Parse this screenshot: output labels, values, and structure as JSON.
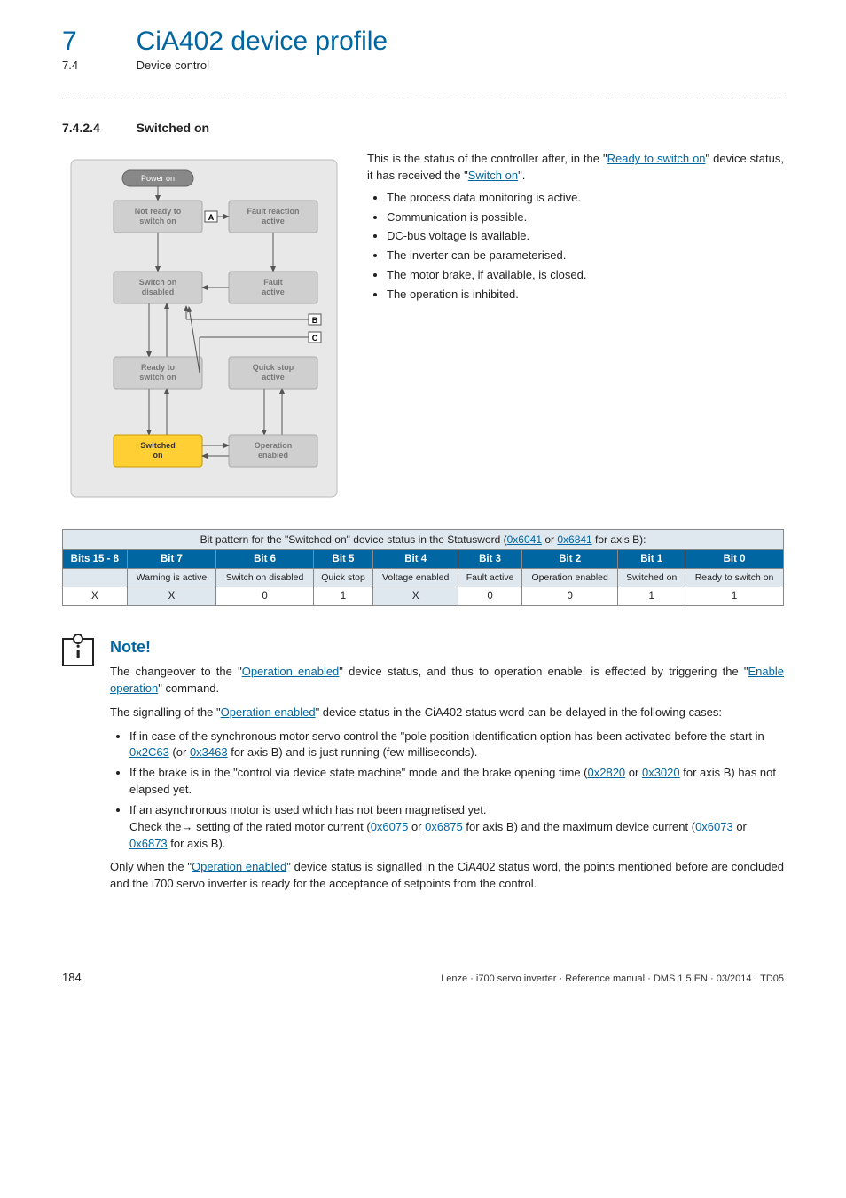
{
  "header": {
    "chapter_num": "7",
    "chapter_title": "CiA402 device profile",
    "sub_num": "7.4",
    "sub_title": "Device control"
  },
  "section": {
    "num": "7.4.2.4",
    "title": "Switched on"
  },
  "diagram": {
    "power_on": "Power on",
    "not_ready": "Not ready to switch on",
    "fault_reaction": "Fault reaction active",
    "switch_on_disabled": "Switch on disabled",
    "fault_active": "Fault active",
    "ready": "Ready to switch on",
    "quick_stop": "Quick stop active",
    "switched_on": "Switched on",
    "operation_enabled": "Operation enabled",
    "label_a": "A",
    "label_b": "B",
    "label_c": "C"
  },
  "right": {
    "intro_1": "This is the status of the controller after, in the \"",
    "link_ready": "Ready to switch on",
    "intro_2": "\" device status, it has received the \"",
    "link_switch_on": "Switch on",
    "intro_3": "\".",
    "bullets": [
      "The process data monitoring is active.",
      "Communication is possible.",
      "DC-bus voltage is available.",
      "The inverter can be parameterised.",
      "The motor brake, if available, is closed.",
      "The operation is inhibited."
    ]
  },
  "table": {
    "caption_1": "Bit pattern for the \"Switched on\" device status in the Statusword (",
    "link1": "0x6041",
    "cap_or": " or ",
    "link2": "0x6841",
    "caption_2": " for axis B):",
    "headers": [
      "Bits 15 - 8",
      "Bit 7",
      "Bit 6",
      "Bit 5",
      "Bit 4",
      "Bit 3",
      "Bit 2",
      "Bit 1",
      "Bit 0"
    ],
    "labels": [
      "",
      "Warning is active",
      "Switch on disabled",
      "Quick stop",
      "Voltage enabled",
      "Fault active",
      "Operation enabled",
      "Switched on",
      "Ready to switch on"
    ],
    "values": [
      "X",
      "X",
      "0",
      "1",
      "X",
      "0",
      "0",
      "1",
      "1"
    ]
  },
  "note": {
    "title": "Note!",
    "p1_a": "The changeover to the \"",
    "link_op_en": "Operation enabled",
    "p1_b": "\" device status, and thus to operation enable, is effected by triggering the \"",
    "link_en_op": "Enable operation",
    "p1_c": "\" command.",
    "p2_a": "The signalling of the \"",
    "p2_b": "\" device status in the CiA402 status word can be delayed in the following cases:",
    "li1_a": "If in case of the synchronous motor servo control the \"pole position identification option has been activated before the start in ",
    "link_2c63": "0x2C63",
    "li1_b": " (or ",
    "link_3463": "0x3463",
    "li1_c": " for axis B) and is just running (few milliseconds).",
    "li2_a": "If the brake is in the \"control via device state machine\" mode and the brake opening time (",
    "link_2820": "0x2820",
    "li2_b": " or ",
    "link_3020": "0x3020",
    "li2_c": " for axis B) has not elapsed yet.",
    "li3_a": "If an asynchronous motor is used which has not been magnetised yet.",
    "li3_b": "Check the→ setting of the rated motor current (",
    "link_6075": "0x6075",
    "li3_c": " or ",
    "link_6875": "0x6875",
    "li3_d": " for axis B) and the maximum device current (",
    "link_6073": "0x6073",
    "li3_e": " or ",
    "link_6873": "0x6873",
    "li3_f": " for axis B).",
    "p3_a": "Only when the \"",
    "p3_b": "\" device status is signalled in the CiA402 status word, the points mentioned before are concluded and the i700 servo inverter is ready for the acceptance of setpoints from the control."
  },
  "footer": {
    "page": "184",
    "info": "Lenze · i700 servo inverter · Reference manual · DMS 1.5 EN · 03/2014 · TD05"
  }
}
